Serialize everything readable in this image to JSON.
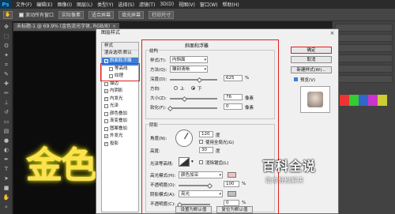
{
  "app": {
    "logo": "Ps"
  },
  "menu": [
    "文件(F)",
    "编辑(E)",
    "图像(I)",
    "图层(L)",
    "类型(Y)",
    "选择(S)",
    "滤镜(T)",
    "3D(D)",
    "视图(V)",
    "窗口(W)",
    "帮助(H)"
  ],
  "options_bar": {
    "scroll_all_label": "滚动所有窗口",
    "buttons": [
      "实际像素",
      "适合屏幕",
      "填充屏幕",
      "打印尺寸"
    ]
  },
  "document_tab": {
    "title": "未标题-1 @ 69.9% (金色流光字体, RGB/8)",
    "close": "×"
  },
  "canvas": {
    "text": "金色",
    "text_color": "#ffe24a"
  },
  "dialog": {
    "title": "图层样式",
    "close": "×",
    "style_list": [
      {
        "label": "样式",
        "type": "header"
      },
      {
        "label": "混合选项:默认",
        "type": "header"
      },
      {
        "label": "斜面和浮雕",
        "checked": true,
        "active": true
      },
      {
        "label": "等高线",
        "checked": false,
        "sub": true
      },
      {
        "label": "纹理",
        "checked": false,
        "sub": true
      },
      {
        "label": "描边",
        "checked": false
      },
      {
        "label": "内阴影",
        "checked": true
      },
      {
        "label": "内发光",
        "checked": true
      },
      {
        "label": "光泽",
        "checked": false
      },
      {
        "label": "颜色叠加",
        "checked": false
      },
      {
        "label": "渐变叠加",
        "checked": false
      },
      {
        "label": "图案叠加",
        "checked": false
      },
      {
        "label": "外发光",
        "checked": true
      },
      {
        "label": "投影",
        "checked": true
      }
    ],
    "bevel": {
      "section_title": "斜面和浮雕",
      "structure_label": "结构",
      "style_label": "样式(T):",
      "style_value": "内斜面",
      "method_label": "方法(Q):",
      "method_value": "雕刻清晰",
      "depth_label": "深度(D):",
      "depth_value": "625",
      "depth_unit": "%",
      "depth_level": 0.62,
      "direction_label": "方向:",
      "direction_up": "上",
      "direction_down": "下",
      "direction_selected": "下",
      "size_label": "大小(Z):",
      "size_value": "76",
      "size_unit": "像素",
      "size_level": 0.3,
      "soften_label": "软化(F):",
      "soften_value": "0",
      "soften_unit": "像素",
      "soften_level": 0.0
    },
    "shading": {
      "section_label": "阴影",
      "angle_label": "角度(N):",
      "angle_value": "120",
      "angle_unit": "度",
      "global_light_label": "使用全局光(G)",
      "altitude_label": "高度:",
      "altitude_value": "30",
      "altitude_unit": "度",
      "gloss_contour_label": "光泽等高线:",
      "anti_alias_label": "消除锯齿(L)",
      "highlight_mode_label": "高光模式(H):",
      "highlight_mode_value": "颜色加深",
      "highlight_color": "#f2c2c2",
      "highlight_opacity_label": "不透明度(O):",
      "highlight_opacity_value": "100",
      "highlight_opacity_unit": "%",
      "shadow_mode_label": "阴影模式(A):",
      "shadow_mode_value": "亮光",
      "shadow_color": "#bfbfbf",
      "shadow_opacity_label": "不透明度(C):",
      "shadow_opacity_value": "0",
      "shadow_opacity_unit": "%"
    },
    "buttons": {
      "ok": "确定",
      "cancel": "取消",
      "new_style": "新建样式(W)...",
      "preview_label": "预览(V)",
      "set_default": "设置为默认值",
      "reset_default": "复位为默认值"
    }
  },
  "watermark": {
    "title": "百科全说",
    "subtitle": "助你轻松解决"
  }
}
